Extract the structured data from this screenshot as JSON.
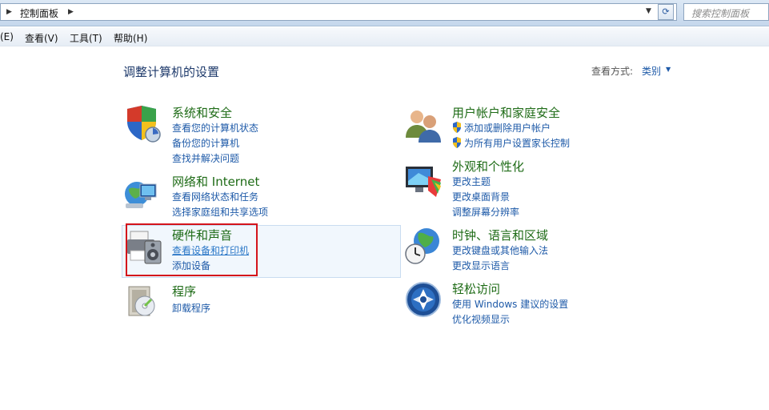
{
  "address": {
    "path": "控制面板",
    "search_placeholder": "搜索控制面板"
  },
  "menu": [
    "(E)",
    "查看(V)",
    "工具(T)",
    "帮助(H)"
  ],
  "page": {
    "title": "调整计算机的设置",
    "view_by_label": "查看方式:",
    "view_by_value": "类别"
  },
  "categories": {
    "system": {
      "title": "系统和安全",
      "links": [
        "查看您的计算机状态",
        "备份您的计算机",
        "查找并解决问题"
      ]
    },
    "network": {
      "title": "网络和 Internet",
      "links": [
        "查看网络状态和任务",
        "选择家庭组和共享选项"
      ]
    },
    "hardware": {
      "title": "硬件和声音",
      "links": [
        "查看设备和打印机",
        "添加设备"
      ]
    },
    "programs": {
      "title": "程序",
      "links": [
        "卸载程序"
      ]
    },
    "users": {
      "title": "用户帐户和家庭安全",
      "links": [
        "添加或删除用户帐户",
        "为所有用户设置家长控制"
      ]
    },
    "appearance": {
      "title": "外观和个性化",
      "links": [
        "更改主题",
        "更改桌面背景",
        "调整屏幕分辨率"
      ]
    },
    "clock": {
      "title": "时钟、语言和区域",
      "links": [
        "更改键盘或其他输入法",
        "更改显示语言"
      ]
    },
    "ease": {
      "title": "轻松访问",
      "links": [
        "使用 Windows 建议的设置",
        "优化视频显示"
      ]
    }
  }
}
